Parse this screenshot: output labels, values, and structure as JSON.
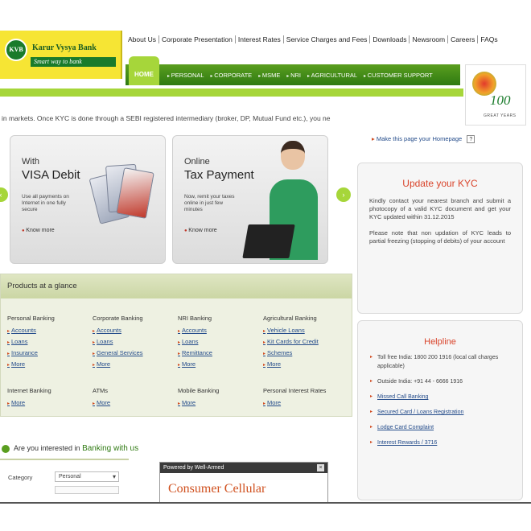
{
  "logo": {
    "badge": "KVB",
    "name": "Karur Vysya Bank",
    "tagline": "Smart way to bank"
  },
  "top_links": [
    "About Us",
    "Corporate Presentation",
    "Interest Rates",
    "Service Charges and Fees",
    "Downloads",
    "Newsroom",
    "Careers",
    "FAQs"
  ],
  "nav": {
    "home": "HOME",
    "items": [
      "PERSONAL",
      "CORPORATE",
      "MSME",
      "NRI",
      "AGRICULTURAL",
      "CUSTOMER SUPPORT"
    ]
  },
  "anniversary": {
    "number": "100",
    "caption": "GREAT YEARS"
  },
  "ticker": "in markets. Once KYC is done through a SEBI registered intermediary (broker, DP, Mutual Fund etc.), you ne",
  "slides": [
    {
      "line1": "With",
      "line2": "VISA Debit",
      "body": "Use all payments on Internet in one fully secure",
      "more": "Know more"
    },
    {
      "line1": "Online",
      "line2": "Tax Payment",
      "body": "Now, remit your taxes online in just few minutes",
      "more": "Know more"
    }
  ],
  "products": {
    "title": "Products at a glance",
    "columns": [
      {
        "title": "Personal Banking",
        "items": [
          "Accounts",
          "Loans",
          "Insurance",
          "More"
        ]
      },
      {
        "title": "Corporate Banking",
        "items": [
          "Accounts",
          "Loans",
          "General Services",
          "More"
        ]
      },
      {
        "title": "NRI Banking",
        "items": [
          "Accounts",
          "Loans",
          "Remittance",
          "More"
        ]
      },
      {
        "title": "Agricultural Banking",
        "items": [
          "Vehicle Loans",
          "Kit Cards for Credit",
          "Schemes",
          "More"
        ]
      },
      {
        "title": "Internet Banking",
        "items": [
          "More"
        ]
      },
      {
        "title": "ATMs",
        "items": [
          "More"
        ]
      },
      {
        "title": "Mobile Banking",
        "items": [
          "More"
        ]
      },
      {
        "title": "Personal Interest Rates",
        "items": [
          "More"
        ]
      }
    ]
  },
  "kyc": {
    "top_link": "Make this page your Homepage",
    "top_help": "?",
    "title": "Update your KYC",
    "para1": "Kindly contact your nearest branch and submit a photocopy of a valid KYC document and get your KYC updated within 31.12.2015",
    "para2": "Please note that non updation of KYC leads to partial freezing (stopping of debits) of your account"
  },
  "helpline": {
    "title": "Helpline",
    "items": [
      {
        "text": "Toll free India: 1800 200 1916 (local call charges applicable)",
        "link": false
      },
      {
        "text": "Outside India: +91 44 - 6666 1916",
        "link": false
      },
      {
        "text": "Missed Call Banking",
        "link": true
      },
      {
        "text": "Secured Card / Loans Registration",
        "link": true
      },
      {
        "text": "Lodge Card Complaint",
        "link": true
      },
      {
        "text": "Interest Rewards / 3716",
        "link": true
      }
    ]
  },
  "interest": {
    "prefix": "Are you interested in",
    "highlight": "Banking with us",
    "category_label": "Category",
    "category_value": "Personal"
  },
  "powered": {
    "bar": "Powered by Well-Armed",
    "close": "×",
    "title": "Consumer Cellular"
  }
}
